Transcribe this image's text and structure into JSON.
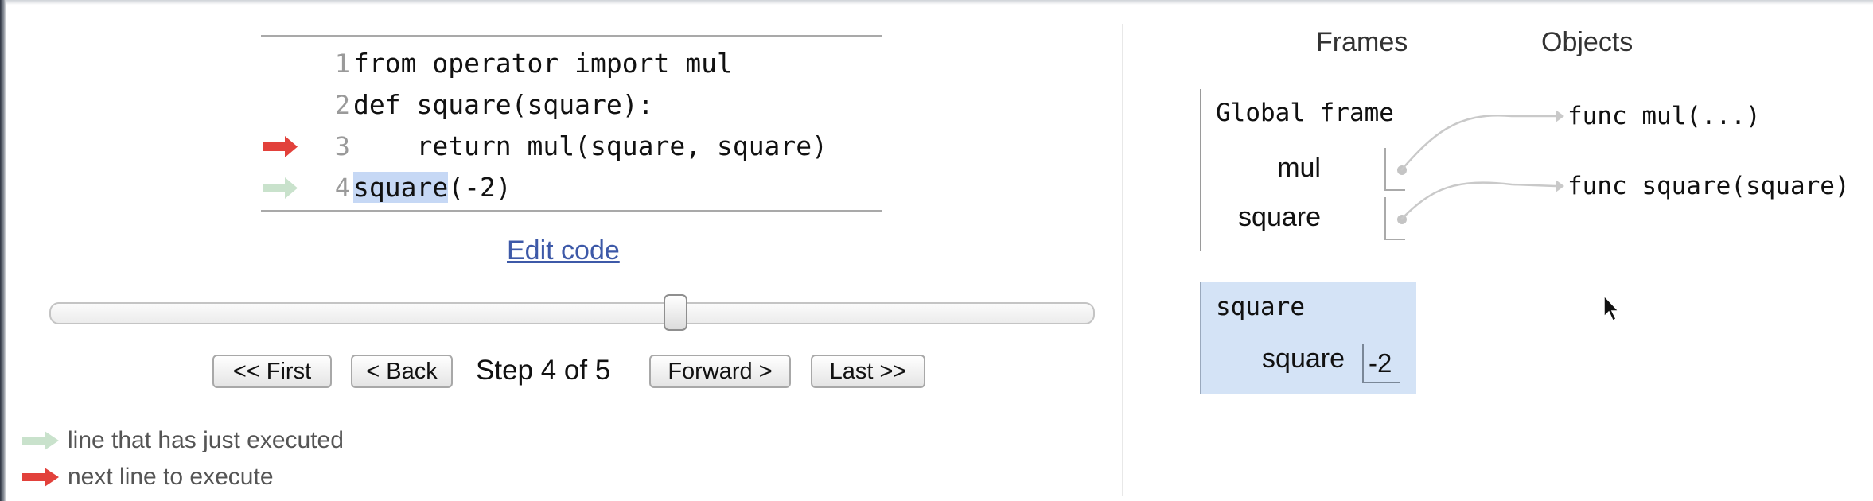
{
  "code": {
    "lines": [
      {
        "num": "1",
        "text": "from operator import mul"
      },
      {
        "num": "2",
        "text": "def square(square):"
      },
      {
        "num": "3",
        "text": "    return mul(square, square)"
      },
      {
        "num": "4",
        "text_highlight": "square",
        "text_rest": "(-2)"
      }
    ],
    "colors": {
      "just_executed_arrow": "#c9e2cc",
      "next_line_arrow": "#e2413b",
      "highlight": "#c6d8f5"
    }
  },
  "edit_link": "Edit code",
  "slider": {
    "position_fraction": 0.6
  },
  "nav": {
    "first": "<< First",
    "back": "< Back",
    "step_text": "Step 4 of 5",
    "forward": "Forward >",
    "last": "Last >>"
  },
  "legend": {
    "just_executed": "line that has just executed",
    "next_line": "next line to execute"
  },
  "viz": {
    "frames_header": "Frames",
    "objects_header": "Objects",
    "global_frame": {
      "title": "Global frame",
      "vars": [
        "mul",
        "square"
      ]
    },
    "objects": [
      "func mul(...)",
      "func square(square)"
    ],
    "active_frame": {
      "title": "square",
      "var_name": "square",
      "var_value": "-2",
      "color": "#d4e3f6"
    }
  }
}
